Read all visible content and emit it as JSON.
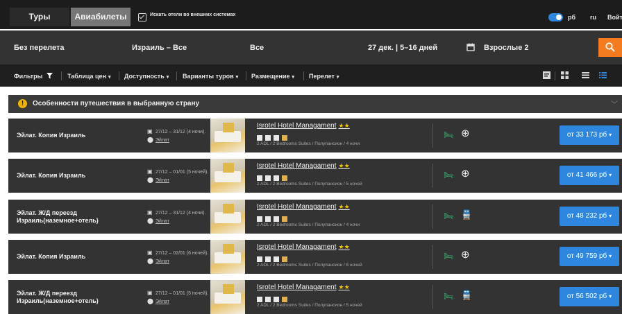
{
  "colors": {
    "accent": "#2e86de",
    "search_button": "#f57b20",
    "warning": "#f1b300",
    "stars": "#f2c300",
    "bed_icon": "#3cc47c"
  },
  "topbar": {
    "tabs": [
      {
        "label": "Туры",
        "active": false
      },
      {
        "label": "Авиабилеты",
        "active": true
      }
    ],
    "external_hotels_label": "Искать отели во внешних системах",
    "external_hotels_checked": true,
    "currency_toggle_on": true,
    "currency": "рб",
    "language": "ru",
    "login": "Войти"
  },
  "search": {
    "flight": "Без перелета",
    "destination": "Израиль – Все",
    "resort": "Все",
    "dates": "27 дек. | 5–16 дней",
    "calendar_icon": "calendar-icon",
    "travelers": "Взрослые 2",
    "search_icon": "search-icon"
  },
  "filters": {
    "items": [
      {
        "label": "Фильтры"
      },
      {
        "label": "Таблица цен"
      },
      {
        "label": "Доступность"
      },
      {
        "label": "Варианты туров"
      },
      {
        "label": "Размещение"
      },
      {
        "label": "Перелет"
      }
    ]
  },
  "notice": {
    "icon": "warning-icon",
    "text": "Особенности путешествия в выбранную страну"
  },
  "results": [
    {
      "title": "Эйлат. Копия Израиль",
      "dates": "27/12 – 31/12 (4 ночи).",
      "location": "Эйлат",
      "hotel": "Isrotel Hotel Managament",
      "stars": "★★",
      "desc": "2 ADL / 2 Bedrooms Suites / Полупансион / 4 ночи",
      "transport_icon": "globe-icon",
      "price": "от 33 173 рб"
    },
    {
      "title": "Эйлат. Копия Израиль",
      "dates": "27/12 – 01/01 (5 ночей).",
      "location": "Эйлат",
      "hotel": "Isrotel Hotel Managament",
      "stars": "★★",
      "desc": "2 ADL / 2 Bedrooms Suites / Полупансион / 5 ночей",
      "transport_icon": "globe-icon",
      "price": "от 41 466 рб"
    },
    {
      "title": "Эйлат. Ж/Д переезд Израиль(наземное+отель)",
      "dates": "27/12 – 31/12 (4 ночи).",
      "location": "Эйлат",
      "hotel": "Isrotel Hotel Managament",
      "stars": "★★",
      "desc": "2 ADL / 2 Bedrooms Suites / Полупансион / 4 ночи",
      "transport_icon": "train-icon",
      "price": "от 48 232 рб"
    },
    {
      "title": "Эйлат. Копия Израиль",
      "dates": "27/12 – 02/01 (6 ночей).",
      "location": "Эйлат",
      "hotel": "Isrotel Hotel Managament",
      "stars": "★★",
      "desc": "2 ADL / 2 Bedrooms Suites / Полупансион / 6 ночей",
      "transport_icon": "globe-icon",
      "price": "от 49 759 рб"
    },
    {
      "title": "Эйлат. Ж/Д переезд Израиль(наземное+отель)",
      "dates": "27/12 – 01/01 (5 ночей).",
      "location": "Эйлат",
      "hotel": "Isrotel Hotel Managament",
      "stars": "★★",
      "desc": "2 ADL / 2 Bedrooms Suites / Полупансион / 5 ночей",
      "transport_icon": "train-icon",
      "price": "от 56 502 рб"
    }
  ]
}
